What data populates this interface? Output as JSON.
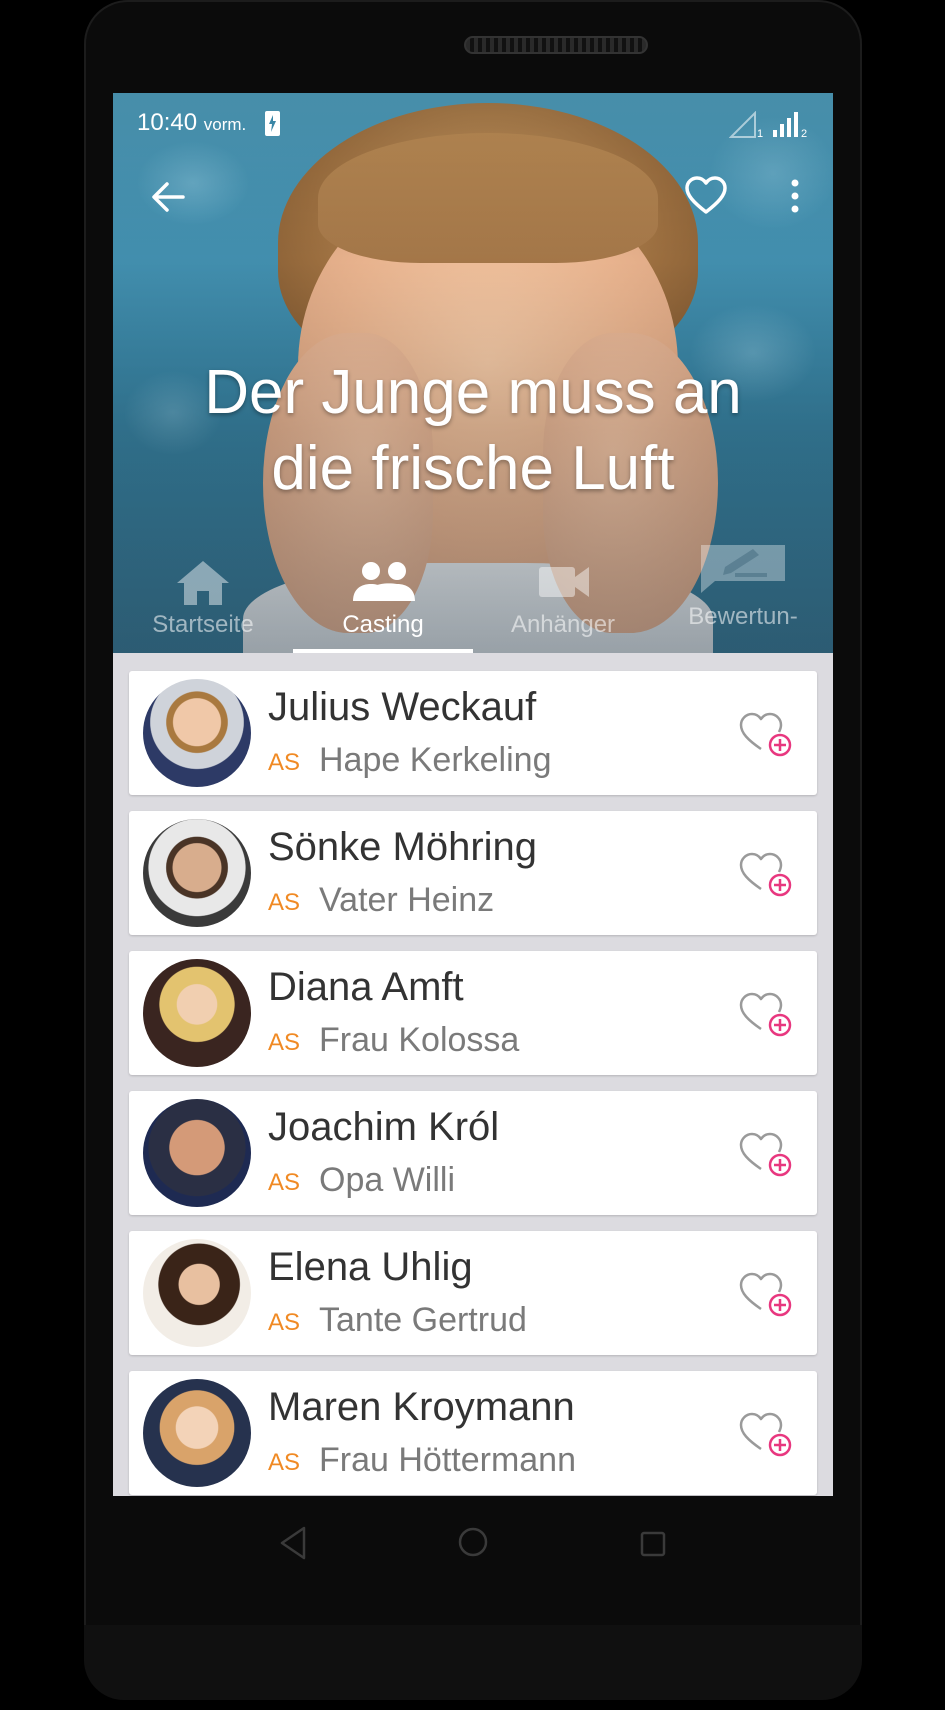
{
  "status_bar": {
    "time": "10:40",
    "time_suffix": "vorm.",
    "sim1": "1",
    "sim2": "2"
  },
  "header": {
    "title": "Der Junge muss an\ndie frische Luft"
  },
  "tabs": [
    {
      "label": "Startseite",
      "icon": "home-icon",
      "active": false
    },
    {
      "label": "Casting",
      "icon": "people-icon",
      "active": true
    },
    {
      "label": "Anhänger",
      "icon": "video-camera-icon",
      "active": false
    },
    {
      "label": "Bewertun-",
      "icon": "rate-review-icon",
      "active": false
    }
  ],
  "cast": [
    {
      "actor": "Julius Weckauf",
      "as": "AS",
      "role": "Hape Kerkeling"
    },
    {
      "actor": "Sönke Möhring",
      "as": "AS",
      "role": "Vater Heinz"
    },
    {
      "actor": "Diana Amft",
      "as": "AS",
      "role": "Frau Kolossa"
    },
    {
      "actor": "Joachim Król",
      "as": "AS",
      "role": "Opa Willi"
    },
    {
      "actor": "Elena Uhlig",
      "as": "AS",
      "role": "Tante Gertrud"
    },
    {
      "actor": "Maren Kroymann",
      "as": "AS",
      "role": "Frau Höttermann"
    }
  ],
  "colors": {
    "accent_pink": "#e8377f",
    "role_prefix_orange": "#f08a24",
    "list_background": "#dcdbe0"
  }
}
